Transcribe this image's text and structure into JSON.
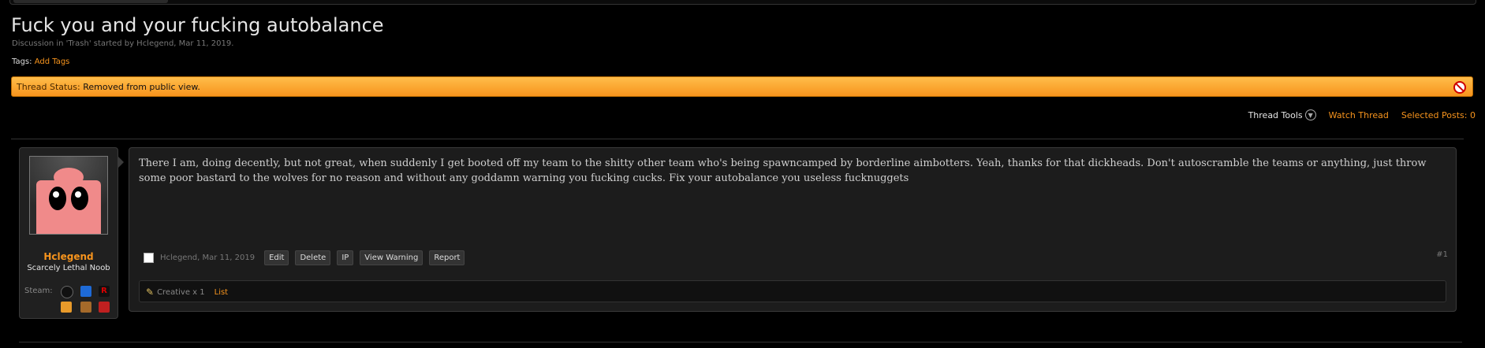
{
  "thread": {
    "title": "Fuck you and your fucking autobalance",
    "description": "Discussion in 'Trash' started by Hclegend, Mar 11, 2019.",
    "tags_label": "Tags:",
    "add_tags": "Add Tags",
    "status_label": "Thread Status:",
    "status_value": "Removed from public view."
  },
  "tools": {
    "thread_tools": "Thread Tools",
    "watch_thread": "Watch Thread",
    "selected_posts": "Selected Posts: 0"
  },
  "user": {
    "name": "Hclegend",
    "title": "Scarcely Lethal Noob",
    "steam_label": "Steam:",
    "game_icons": [
      "steam-icon",
      "battlenet-icon",
      "roblox-icon",
      "tf2-icon",
      "game-icon",
      "dota-icon"
    ]
  },
  "post": {
    "message": "There I am, doing decently, but not great, when suddenly I get booted off my team to the shitty other team who's being spawncamped by borderline aimbotters. Yeah, thanks for that dickheads. Don't autoscramble the teams or anything, just throw some poor bastard to the wolves for no reason and without any goddamn warning you fucking cucks. Fix your autobalance you useless fucknuggets",
    "author_date": "Hclegend, Mar 11, 2019",
    "buttons": [
      "Edit",
      "Delete",
      "IP",
      "View Warning",
      "Report"
    ],
    "number": "#1",
    "rating_label": "Creative x 1",
    "rating_list": "List"
  },
  "colors": {
    "accent": "#f7941d",
    "background": "#000000",
    "panel": "#1c1c1c"
  }
}
